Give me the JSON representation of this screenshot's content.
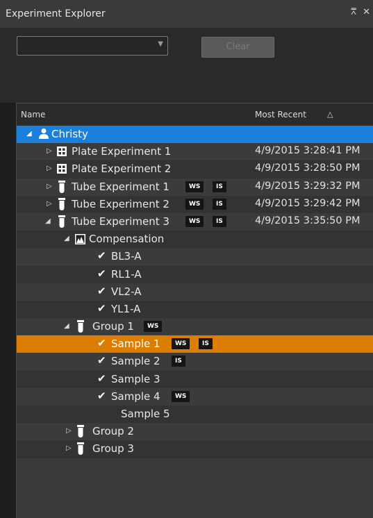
{
  "window": {
    "title": "Experiment Explorer",
    "pin_icon": "pin-icon",
    "close_icon": "close-icon"
  },
  "toolbar": {
    "combo_value": "",
    "clear_label": "Clear"
  },
  "columns": {
    "name": "Name",
    "most_recent": "Most Recent",
    "sort_glyph": "△"
  },
  "colors": {
    "selected_root": "#1d7fdc",
    "selected_item": "#dc7d00",
    "badge_bg": "#151515"
  },
  "tree": {
    "root": {
      "label": "Christy"
    },
    "experiments": [
      {
        "label": "Plate Experiment 1",
        "date": "4/9/2015 3:28:41 PM"
      },
      {
        "label": "Plate Experiment 2",
        "date": "4/9/2015 3:28:50 PM"
      },
      {
        "label": "Tube Experiment 1",
        "date": "4/9/2015 3:29:32 PM",
        "ws": "WS",
        "is": "IS"
      },
      {
        "label": "Tube Experiment 2",
        "date": "4/9/2015 3:29:42 PM",
        "ws": "WS",
        "is": "IS"
      },
      {
        "label": "Tube Experiment 3",
        "date": "4/9/2015 3:35:50 PM",
        "ws": "WS",
        "is": "IS"
      }
    ],
    "compensation": {
      "label": "Compensation",
      "items": [
        "BL3-A",
        "RL1-A",
        "VL2-A",
        "YL1-A"
      ]
    },
    "groups": [
      {
        "label": "Group 1",
        "ws": "WS"
      },
      {
        "label": "Group 2"
      },
      {
        "label": "Group 3"
      }
    ],
    "samples": [
      {
        "label": "Sample 1",
        "ws": "WS",
        "is": "IS"
      },
      {
        "label": "Sample 2",
        "is": "IS"
      },
      {
        "label": "Sample 3"
      },
      {
        "label": "Sample 4",
        "ws": "WS"
      },
      {
        "label": "Sample 5"
      }
    ]
  }
}
